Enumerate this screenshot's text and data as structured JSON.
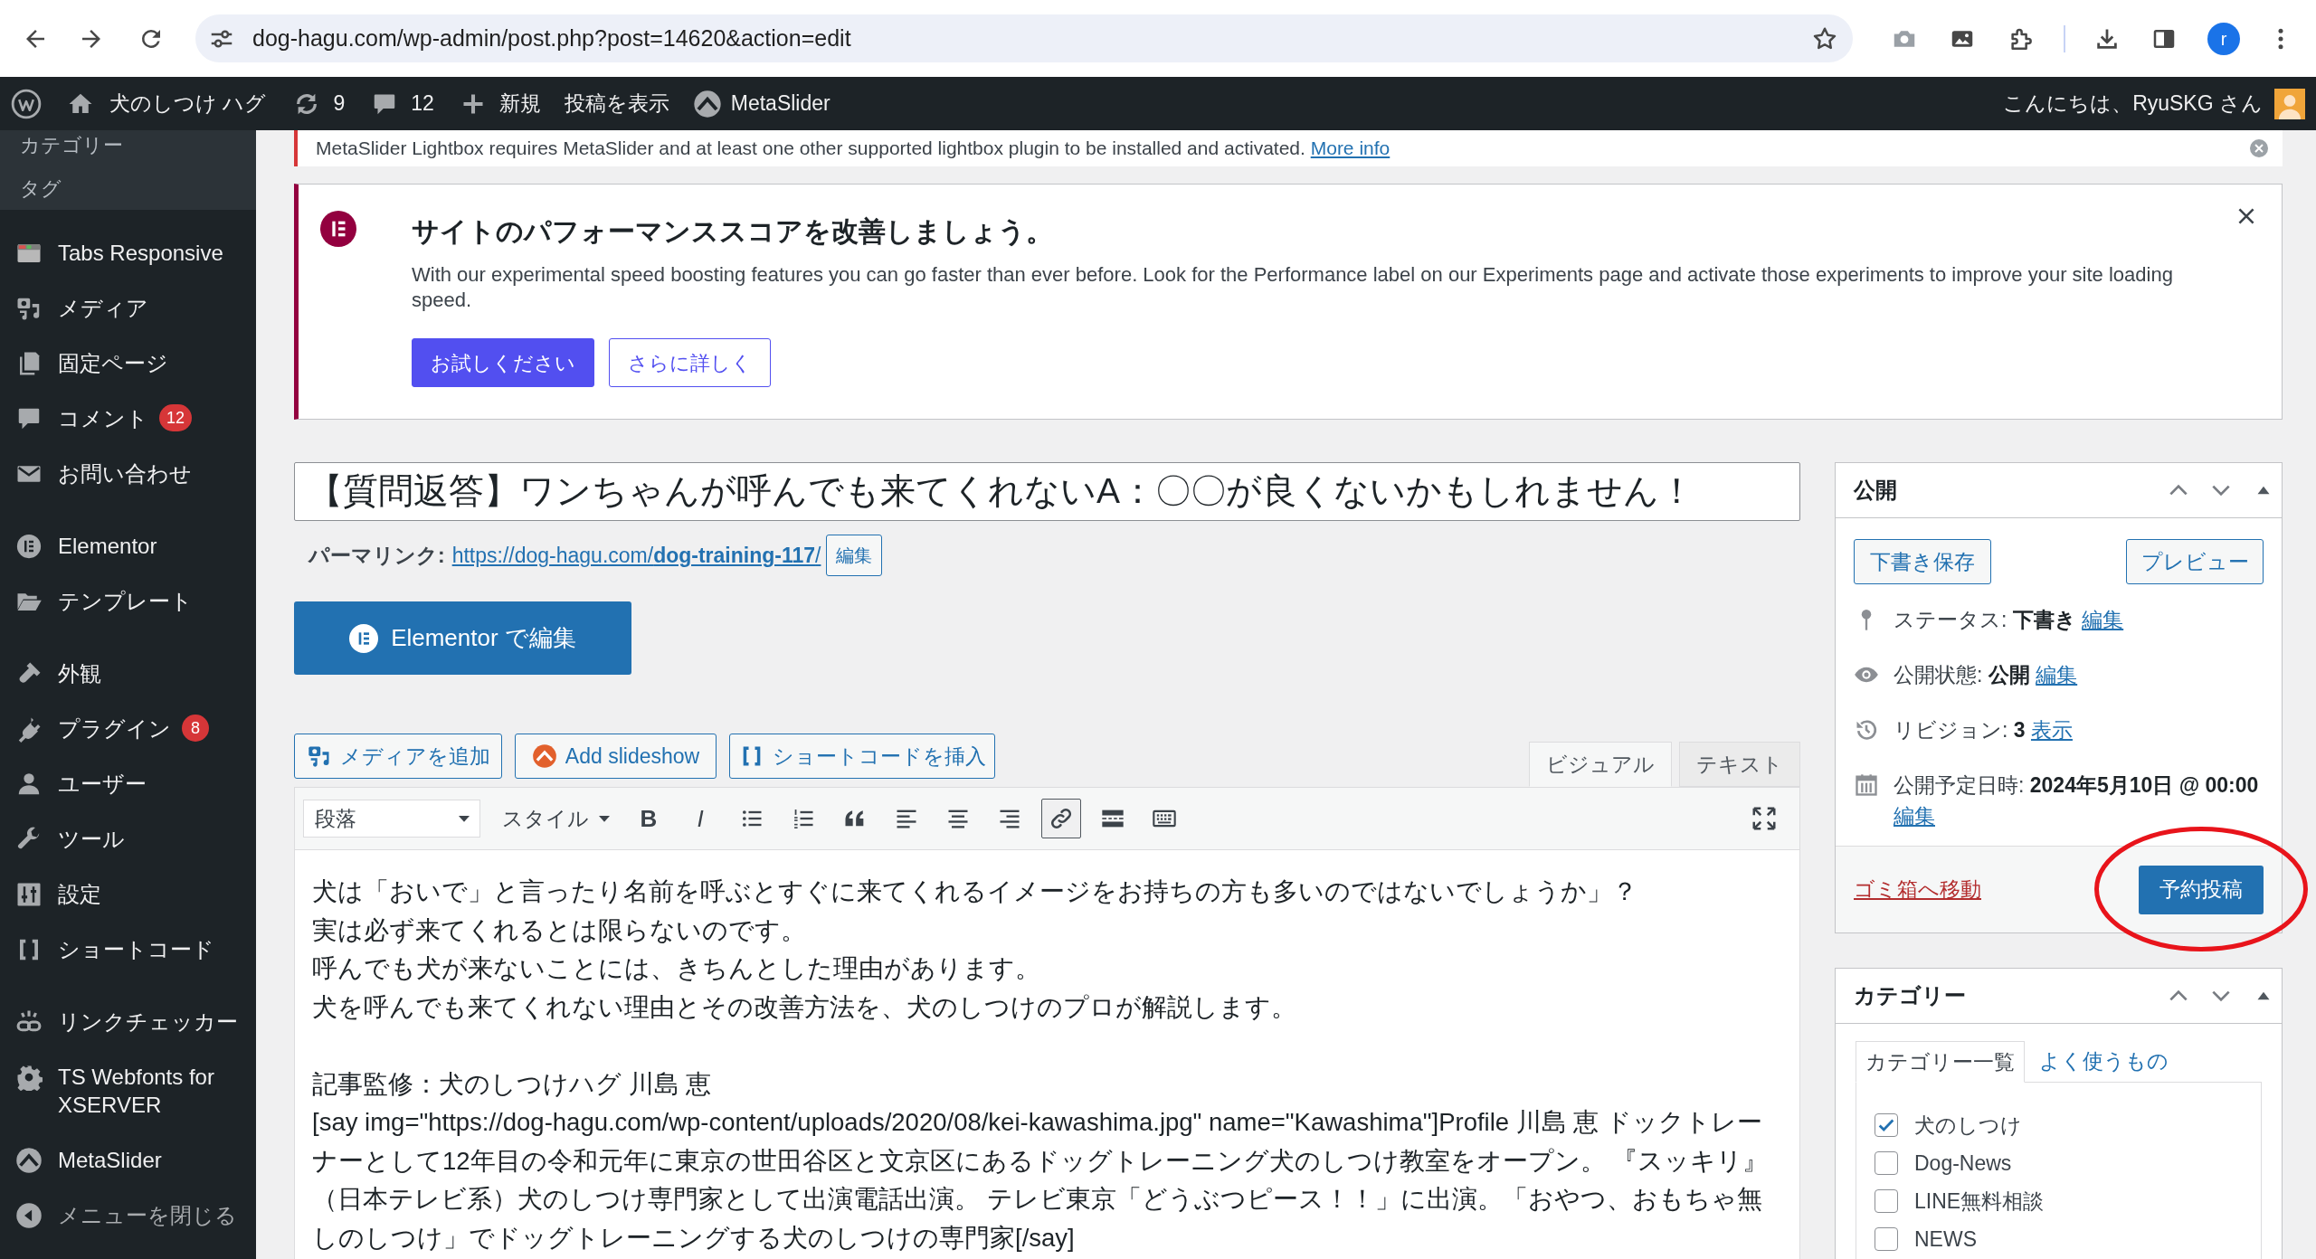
{
  "browser": {
    "url": "dog-hagu.com/wp-admin/post.php?post=14620&action=edit",
    "profile_initial": "r"
  },
  "admin_bar": {
    "site_name": "犬のしつけ ハグ",
    "updates": "9",
    "comments": "12",
    "new": "新規",
    "view_post": "投稿を表示",
    "metaslider": "MetaSlider",
    "greeting": "こんにちは、RyuSKG さん"
  },
  "sidebar": {
    "submenu": [
      {
        "label": "カテゴリー"
      },
      {
        "label": "タグ"
      }
    ],
    "groups": [
      [
        {
          "label": "Tabs Responsive"
        },
        {
          "label": "メディア"
        },
        {
          "label": "固定ページ"
        },
        {
          "label": "コメント",
          "badge": "12"
        },
        {
          "label": "お問い合わせ"
        }
      ],
      [
        {
          "label": "Elementor"
        },
        {
          "label": "テンプレート"
        }
      ],
      [
        {
          "label": "外観"
        },
        {
          "label": "プラグイン",
          "badge": "8"
        },
        {
          "label": "ユーザー"
        },
        {
          "label": "ツール"
        },
        {
          "label": "設定"
        },
        {
          "label": "ショートコード"
        }
      ],
      [
        {
          "label": "リンクチェッカー"
        },
        {
          "label": "TS Webfonts for XSERVER"
        },
        {
          "label": "MetaSlider"
        }
      ]
    ],
    "collapse": "メニューを閉じる"
  },
  "notices": [
    {
      "kind": "plugin-warning",
      "text": "MetaSlider Lightbox requires MetaSlider and at least one other supported lightbox plugin to be installed and activated.",
      "link": "More info"
    },
    {
      "kind": "promo",
      "title": "サイトのパフォーマンススコアを改善しましょう。",
      "text": "With our experimental speed boosting features you can go faster than ever before. Look for the Performance label on our Experiments page and activate those experiments to improve your site loading speed.",
      "buttons": [
        {
          "label": "お試しください",
          "primary": true
        },
        {
          "label": "さらに詳しく",
          "primary": false
        }
      ]
    }
  ],
  "editor": {
    "title": "【質問返答】ワンちゃんが呼んでも来てくれないA：〇〇が良くないかもしれません！",
    "permalink": {
      "label": "パーマリンク:",
      "url": "https://dog-hagu.com/**dog-training-117**/",
      "edit": "編集"
    },
    "elementor_button": "Elementor で編集",
    "media_buttons": [
      {
        "label": "メディアを追加"
      },
      {
        "label": "Add slideshow"
      },
      {
        "label": "ショートコードを挿入"
      }
    ],
    "tabs": [
      {
        "label": "ビジュアル",
        "selected": true
      },
      {
        "label": "テキスト",
        "selected": false
      }
    ],
    "format": "段落",
    "style_menu": "スタイル",
    "toolbar": [
      {
        "label": "B",
        "active": false
      },
      {
        "label": "I",
        "active": false
      },
      {
        "active": false
      },
      {
        "active": false
      },
      {
        "active": false
      },
      {
        "active": false
      },
      {
        "active": false
      },
      {
        "active": false
      },
      {
        "active": true
      },
      {
        "active": false
      },
      {
        "active": false
      }
    ],
    "paragraphs": [
      {
        "lines": [
          "犬は「おいで」と言ったり名前を呼ぶとすぐに来てくれるイメージをお持ちの方も多いのではないでしょうか」？",
          "実は必ず来てくれるとは限らないのです。",
          "呼んでも犬が来ないことには、きちんとした理由があります。",
          "犬を呼んでも来てくれない理由とその改善方法を、犬のしつけのプロが解説します。"
        ]
      },
      {
        "lines": [
          "記事監修：犬のしつけハグ 川島 恵",
          "[say img=\"https://dog-hagu.com/wp-content/uploads/2020/08/kei-kawashima.jpg\" name=\"Kawashima\"]Profile 川島 恵 ドックトレーナーとして12年目の令和元年に東京の世田谷区と文京区にあるドッグトレーニング犬のしつけ教室をオープン。 『スッキリ』（日本テレビ系）犬のしつけ専門家として出演電話出演。 テレビ東京「どうぶつピース！！」に出演。「おやつ、おもちゃ無しのしつけ」でドッグトレーニングする犬のしつけの専門家[/say]"
        ]
      }
    ]
  },
  "sidebar_panels": {
    "publish": {
      "title": "公開",
      "save_draft": "下書き保存",
      "preview": "プレビュー",
      "rows": [
        {
          "label": "ステータス:",
          "value": "下書き",
          "link": "編集"
        },
        {
          "label": "公開状態:",
          "value": "公開",
          "link": "編集"
        },
        {
          "label": "リビジョン:",
          "value": "3",
          "link": "表示"
        },
        {
          "label": "公開予定日時:",
          "value": "2024年5月10日 @ 00:00",
          "link": "編集"
        }
      ],
      "trash": "ゴミ箱へ移動",
      "publish_button": {
        "label": "予約投稿",
        "highlighted": true
      }
    },
    "categories": {
      "title": "カテゴリー",
      "tabs": [
        {
          "label": "カテゴリー一覧",
          "selected": true
        },
        {
          "label": "よく使うもの",
          "selected": false
        }
      ],
      "items": [
        {
          "label": "犬のしつけ",
          "checked": true
        },
        {
          "label": "Dog-News",
          "checked": false
        },
        {
          "label": "LINE無料相談",
          "checked": false
        },
        {
          "label": "NEWS",
          "checked": false
        }
      ]
    }
  }
}
